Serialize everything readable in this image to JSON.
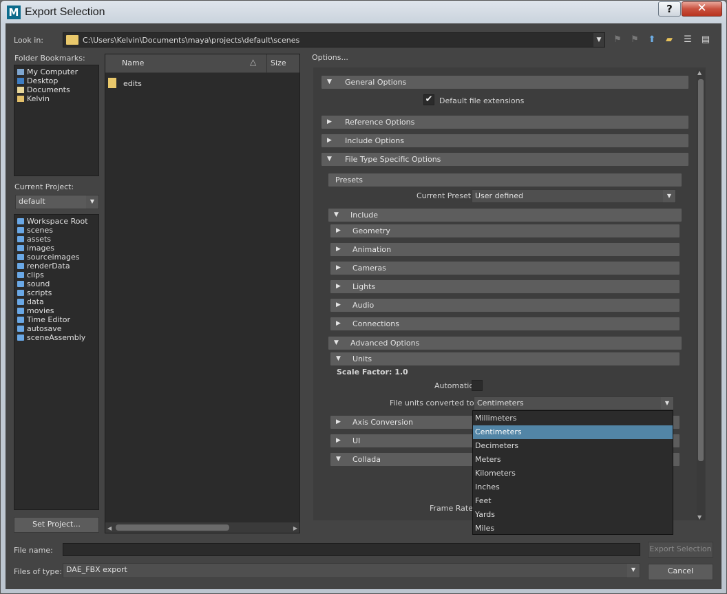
{
  "window": {
    "title": "Export Selection",
    "logo": "M",
    "help": "?",
    "close": "✕"
  },
  "lookin": {
    "label": "Look in:",
    "path": "C:\\Users\\Kelvin\\Documents\\maya\\projects\\default\\scenes"
  },
  "bookmarks": {
    "label": "Folder Bookmarks:",
    "items": [
      "My Computer",
      "Desktop",
      "Documents",
      "Kelvin"
    ]
  },
  "project": {
    "label": "Current Project:",
    "value": "default",
    "folders": [
      "Workspace Root",
      "scenes",
      "assets",
      "images",
      "sourceimages",
      "renderData",
      "clips",
      "sound",
      "scripts",
      "data",
      "movies",
      "Time Editor",
      "autosave",
      "sceneAssembly"
    ],
    "set_button": "Set Project..."
  },
  "filelist": {
    "col_name": "Name",
    "col_size": "Size",
    "items": [
      "edits"
    ]
  },
  "options": {
    "label": "Options...",
    "general": "General Options",
    "default_ext": "Default file extensions",
    "reference": "Reference Options",
    "include_opts": "Include Options",
    "filetype": "File Type Specific Options",
    "presets": "Presets",
    "current_preset_label": "Current Preset:",
    "current_preset": "User defined",
    "include": "Include",
    "geometry": "Geometry",
    "animation": "Animation",
    "cameras": "Cameras",
    "lights": "Lights",
    "audio": "Audio",
    "connections": "Connections",
    "advanced": "Advanced Options",
    "units": "Units",
    "scale_factor": "Scale Factor: 1.0",
    "automatic": "Automatic",
    "file_units_label": "File units converted to:",
    "file_units": "Centimeters",
    "axis": "Axis Conversion",
    "ui": "UI",
    "collada": "Collada",
    "frame_rate": "Frame Rate:"
  },
  "units_popup": [
    "Millimeters",
    "Centimeters",
    "Decimeters",
    "Meters",
    "Kilometers",
    "Inches",
    "Feet",
    "Yards",
    "Miles"
  ],
  "bottom": {
    "file_name_label": "File name:",
    "file_name": "",
    "files_type_label": "Files of type:",
    "files_type": "DAE_FBX export",
    "export_button": "Export Selection",
    "cancel_button": "Cancel"
  },
  "colors": {
    "background": "#444444",
    "panel": "#2b2b2b",
    "frame": "#5d5d5d",
    "highlight": "#5285a6"
  }
}
